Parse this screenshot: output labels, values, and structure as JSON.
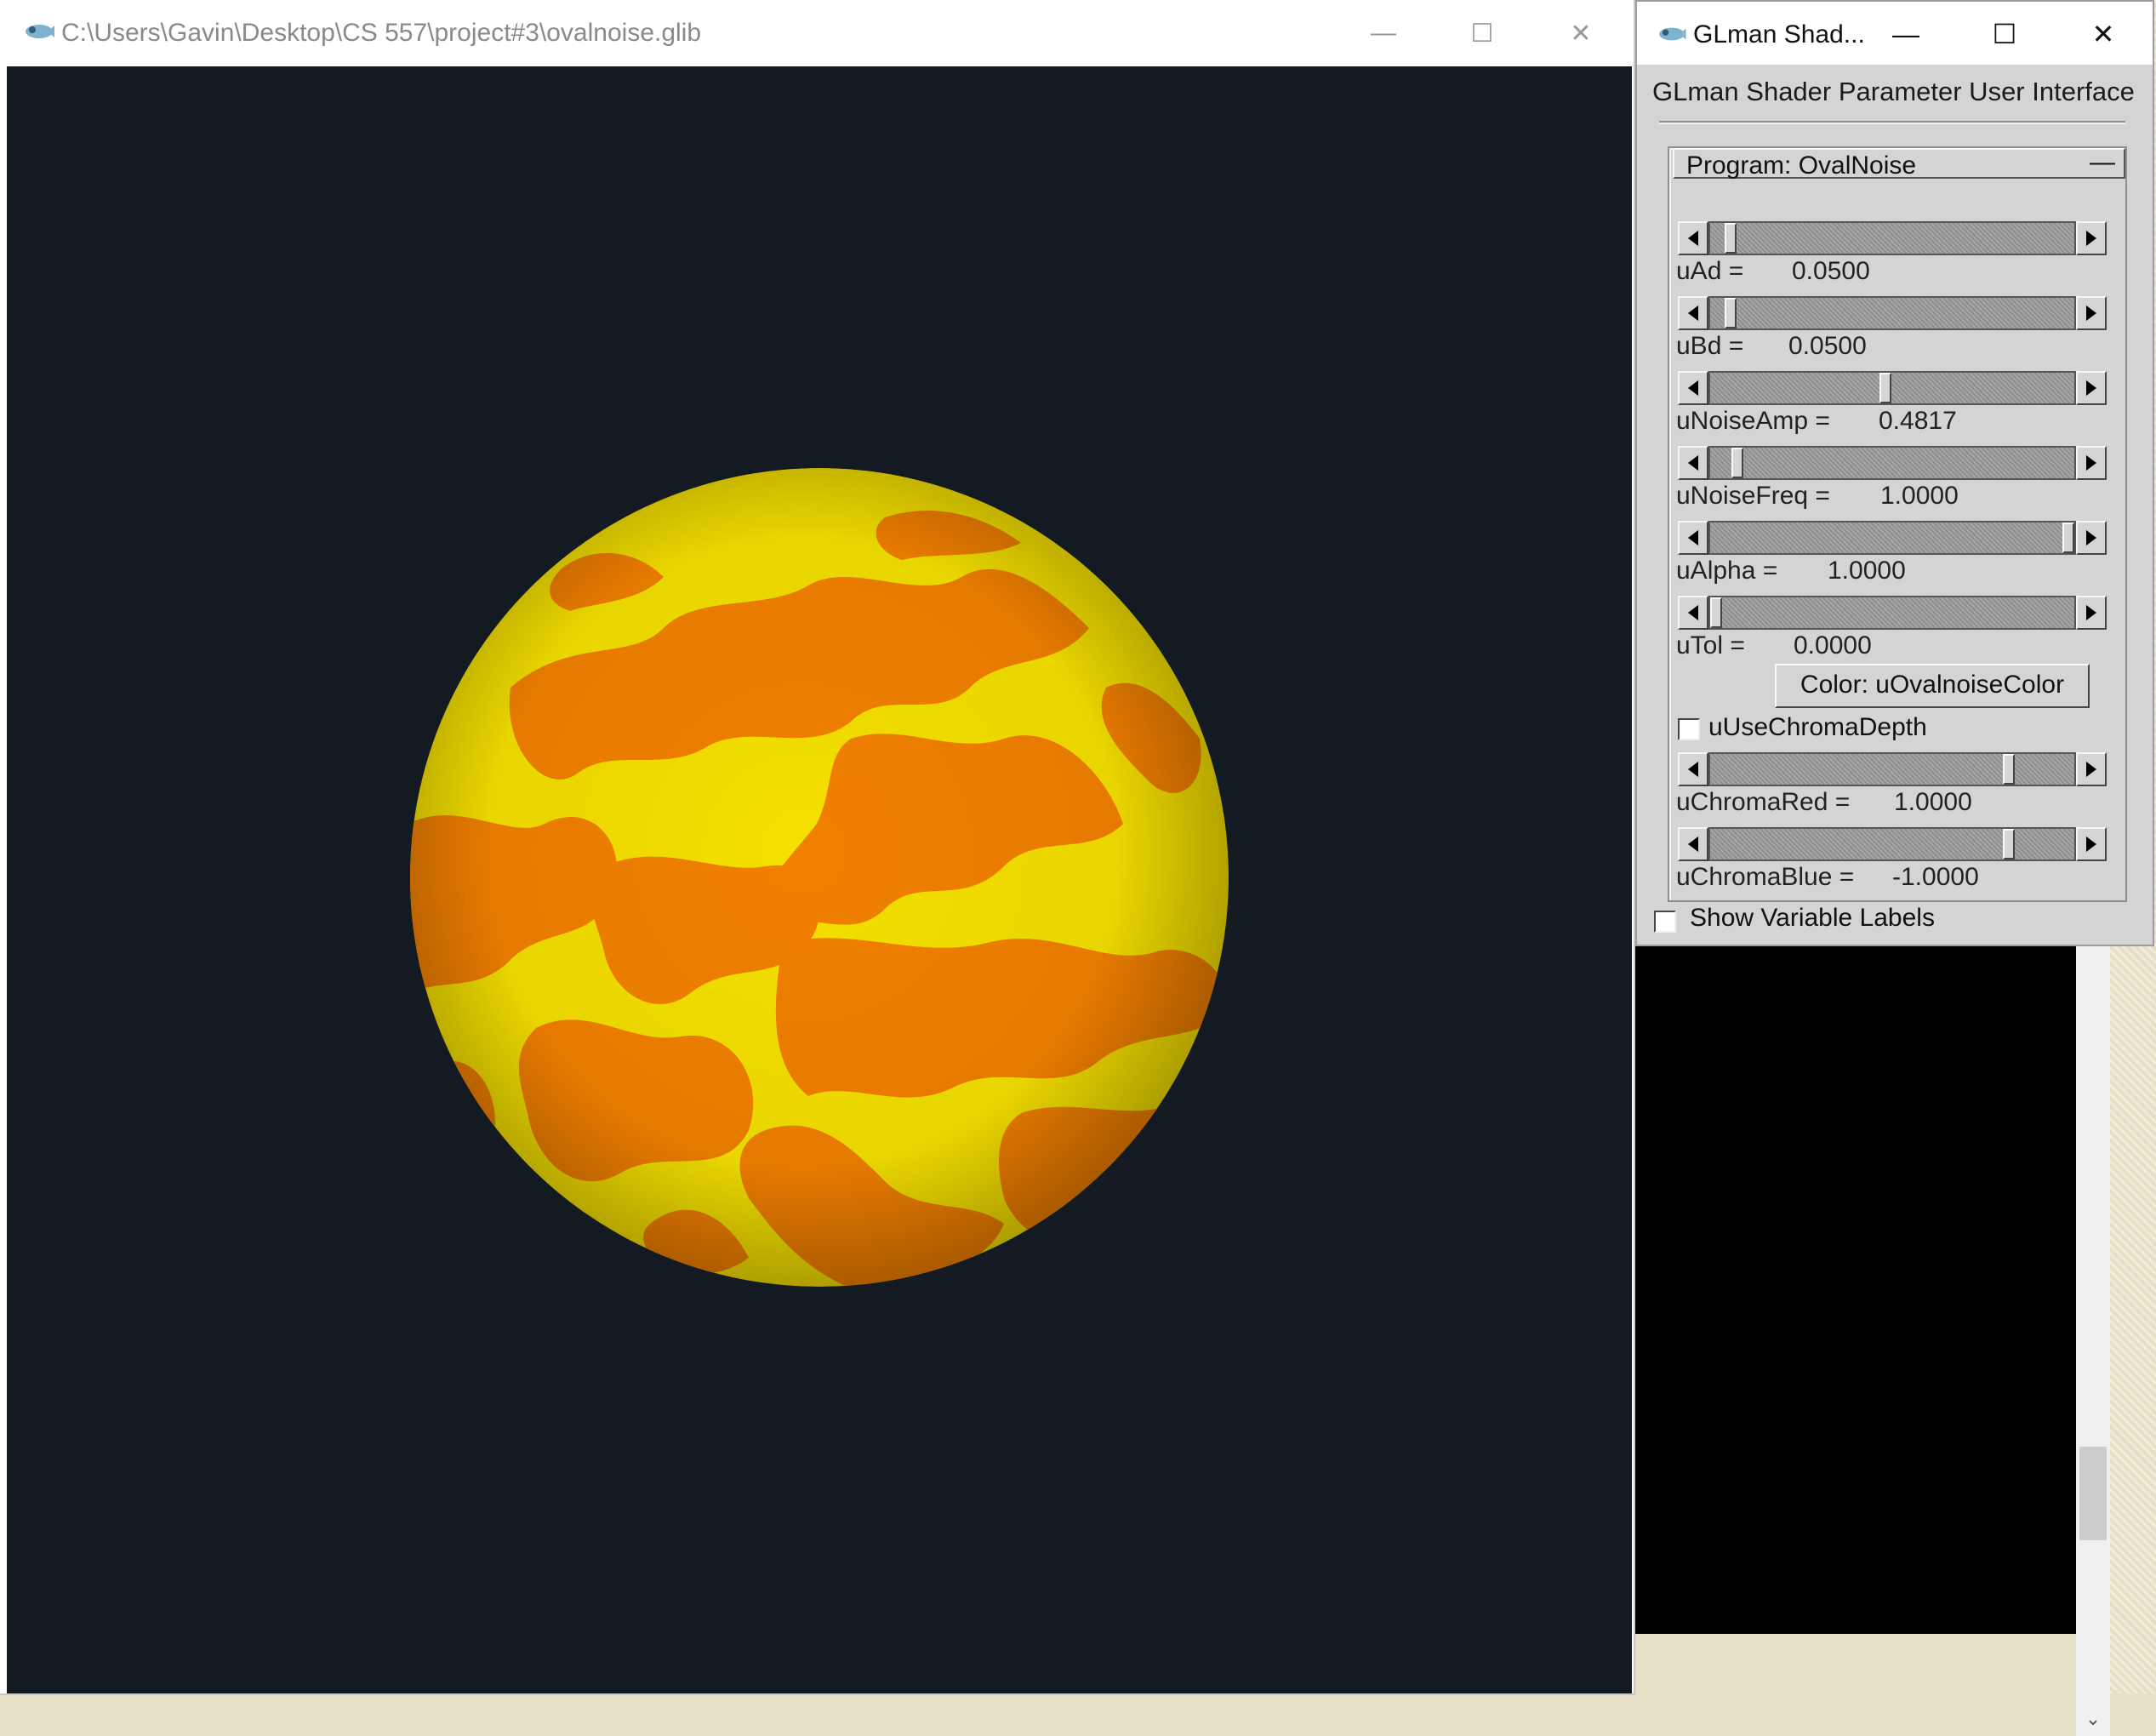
{
  "main_window": {
    "title": "C:\\Users\\Gavin\\Desktop\\CS 557\\project#3\\ovalnoise.glib",
    "minimize": "—",
    "maximize": "☐",
    "close": "✕",
    "viewport_background": "#131a21",
    "sphere_colors": {
      "base": "#f5e000",
      "spots": "#f28000"
    }
  },
  "panel": {
    "title": "GLman Shad...",
    "minimize": "—",
    "maximize": "☐",
    "close": "✕",
    "heading": "GLman Shader Parameter User Interface",
    "rollout_label": "Program: OvalNoise",
    "rollout_toggle": "—",
    "params": [
      {
        "name": "uAd =",
        "value": "0.0500",
        "fraction": 0.04
      },
      {
        "name": "uBd =",
        "value": "0.0500",
        "fraction": 0.04
      },
      {
        "name": "uNoiseAmp =",
        "value": "0.4817",
        "fraction": 0.48
      },
      {
        "name": "uNoiseFreq =",
        "value": "1.0000",
        "fraction": 0.06
      },
      {
        "name": "uAlpha =",
        "value": "1.0000",
        "fraction": 1.0
      },
      {
        "name": "uTol =",
        "value": "0.0000",
        "fraction": 0.0
      }
    ],
    "color_button": "Color: uOvalnoiseColor",
    "chroma_checkbox": {
      "label": "uUseChromaDepth",
      "checked": false
    },
    "chroma_params": [
      {
        "name": "uChromaRed =",
        "value": "1.0000",
        "fraction": 0.83
      },
      {
        "name": "uChromaBlue =",
        "value": "-1.0000",
        "fraction": 0.83
      }
    ],
    "show_labels": {
      "label": "Show Variable Labels",
      "checked": false
    }
  }
}
